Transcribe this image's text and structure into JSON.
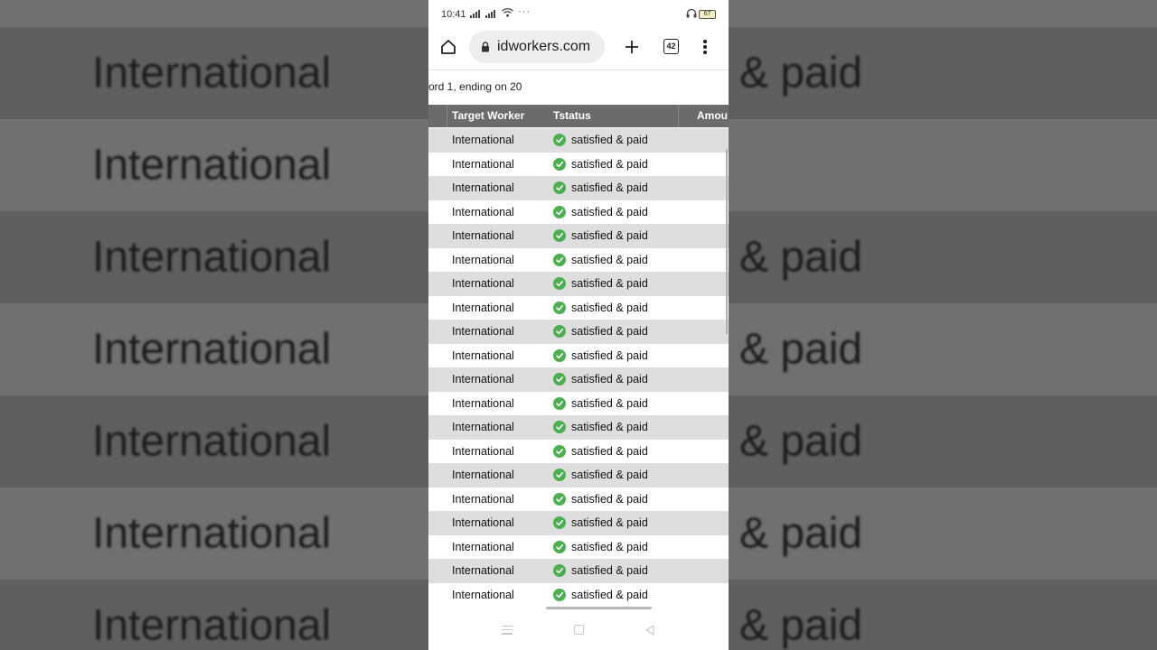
{
  "background": {
    "left_text": "International",
    "right_text": "& paid"
  },
  "status_bar": {
    "time": "10:41",
    "overflow": "···",
    "battery": "67"
  },
  "browser": {
    "url": "idworkers.com",
    "tab_count": "42"
  },
  "page": {
    "record_text": "ord 1, ending on 20",
    "columns": [
      "Target Worker",
      "Tstatus",
      "Amou"
    ],
    "rows": [
      {
        "worker": "International",
        "status": "satisfied & paid"
      },
      {
        "worker": "International",
        "status": "satisfied & paid"
      },
      {
        "worker": "International",
        "status": "satisfied & paid"
      },
      {
        "worker": "International",
        "status": "satisfied & paid"
      },
      {
        "worker": "International",
        "status": "satisfied & paid"
      },
      {
        "worker": "International",
        "status": "satisfied & paid"
      },
      {
        "worker": "International",
        "status": "satisfied & paid"
      },
      {
        "worker": "International",
        "status": "satisfied & paid"
      },
      {
        "worker": "International",
        "status": "satisfied & paid"
      },
      {
        "worker": "International",
        "status": "satisfied & paid"
      },
      {
        "worker": "International",
        "status": "satisfied & paid"
      },
      {
        "worker": "International",
        "status": "satisfied & paid"
      },
      {
        "worker": "International",
        "status": "satisfied & paid"
      },
      {
        "worker": "International",
        "status": "satisfied & paid"
      },
      {
        "worker": "International",
        "status": "satisfied & paid"
      },
      {
        "worker": "International",
        "status": "satisfied & paid"
      },
      {
        "worker": "International",
        "status": "satisfied & paid"
      },
      {
        "worker": "International",
        "status": "satisfied & paid"
      },
      {
        "worker": "International",
        "status": "satisfied & paid"
      },
      {
        "worker": "International",
        "status": "satisfied & paid"
      }
    ]
  },
  "colors": {
    "header_bg": "#6b6b6b",
    "row_alt_bg": "#dedede",
    "status_check": "#4caf50"
  }
}
